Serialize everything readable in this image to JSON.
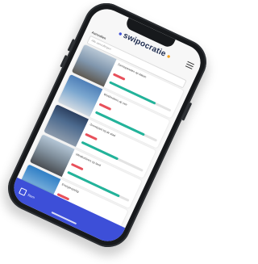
{
  "header": {
    "logo_text": "swipocratie",
    "logo_dot_left": "●",
    "logo_dot_right": "●",
    "menu_icon": "hamburger-menu-icon"
  },
  "filter": {
    "label": "Aanvullen",
    "placeholder": "Alle aanvullingen"
  },
  "cards": [
    {
      "title": "Zonnepanelen op daken",
      "progress": 0.75,
      "image_icon": "rooftop-photo"
    },
    {
      "title": "Windmolens op zee",
      "progress": 0.8,
      "image_icon": "wind-turbine-photo"
    },
    {
      "title": "Zonnepark bij de stad",
      "progress": 0.6,
      "image_icon": "solar-park-photo"
    },
    {
      "title": "Windturbines op land",
      "progress": 0.85,
      "image_icon": "wind-field-photo"
    },
    {
      "title": "Energieopslag",
      "progress": 0.55,
      "image_icon": "city-sky-photo"
    }
  ],
  "bottom_nav": {
    "label": "Stem",
    "icon": "list-icon"
  },
  "colors": {
    "accent": "#3d4fd8",
    "pill_red": "#e8505b",
    "bar_green": "#22b39a"
  }
}
